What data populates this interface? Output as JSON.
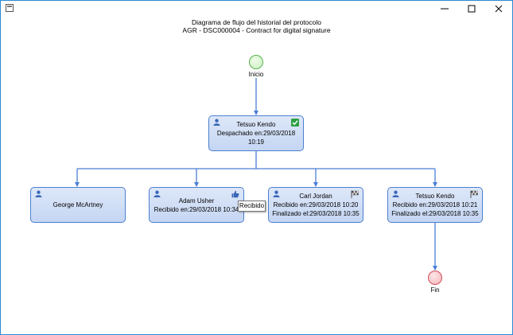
{
  "window": {
    "title_line1": "Diagrama de flujo del historial del protocolo",
    "title_line2": "AGR - DSC000004 - Contract for digital signature",
    "controls": [
      "minimize-icon",
      "maximize-icon",
      "close-icon"
    ]
  },
  "colors": {
    "connector": "#4b7fd6",
    "node_border": "#4a7fd0",
    "start_fill": "#c8f0c0",
    "end_fill": "#f6b3b8",
    "check_badge": "#2ea043"
  },
  "flow": {
    "start": {
      "label": "Inicio"
    },
    "end": {
      "label": "Fin"
    },
    "dispatcher": {
      "name": "Tetsuo Kendo",
      "line2": "Despachado en:29/03/2018 10:19",
      "badge": "check-icon"
    },
    "recipients": [
      {
        "name": "George McArtney",
        "icon": "user-icon"
      },
      {
        "name": "Adam Usher",
        "line2": "Recibido en:29/03/2018 10:34",
        "badge": "thumbs-up-icon"
      },
      {
        "name": "Carl Jordan",
        "line2": "Recibido en:29/03/2018 10:20",
        "line3": "Finalizado el:29/03/2018 10:35",
        "badge": "checkered-flag-icon"
      },
      {
        "name": "Tetsuo Kendo",
        "line2": "Recibido en:29/03/2018 10:21",
        "line3": "Finalizado el:29/03/2018 10:35",
        "badge": "checkered-flag-icon"
      }
    ]
  },
  "tooltip": {
    "text": "Recibido"
  }
}
